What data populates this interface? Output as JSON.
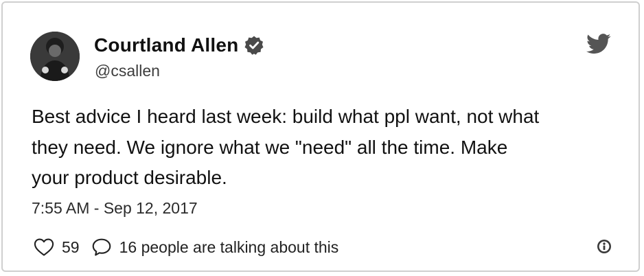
{
  "tweet": {
    "author": {
      "display_name": "Courtland Allen",
      "handle": "@csallen",
      "verified": true
    },
    "text": "Best advice I heard last week: build what ppl want, not what\nthey need. We ignore what we \"need\" all the time. Make\nyour product desirable.",
    "timestamp": "7:55 AM - Sep 12, 2017",
    "likes": "59",
    "conversation_label": "16 people are talking about this"
  },
  "icons": {
    "brand": "twitter-bird-icon",
    "verified": "verified-badge-icon",
    "like": "heart-icon",
    "reply": "speech-bubble-icon",
    "info": "info-icon"
  },
  "colors": {
    "text": "#111111",
    "secondary_text": "#3d3d3d",
    "icon": "#555555",
    "border": "#cfcfcf"
  }
}
